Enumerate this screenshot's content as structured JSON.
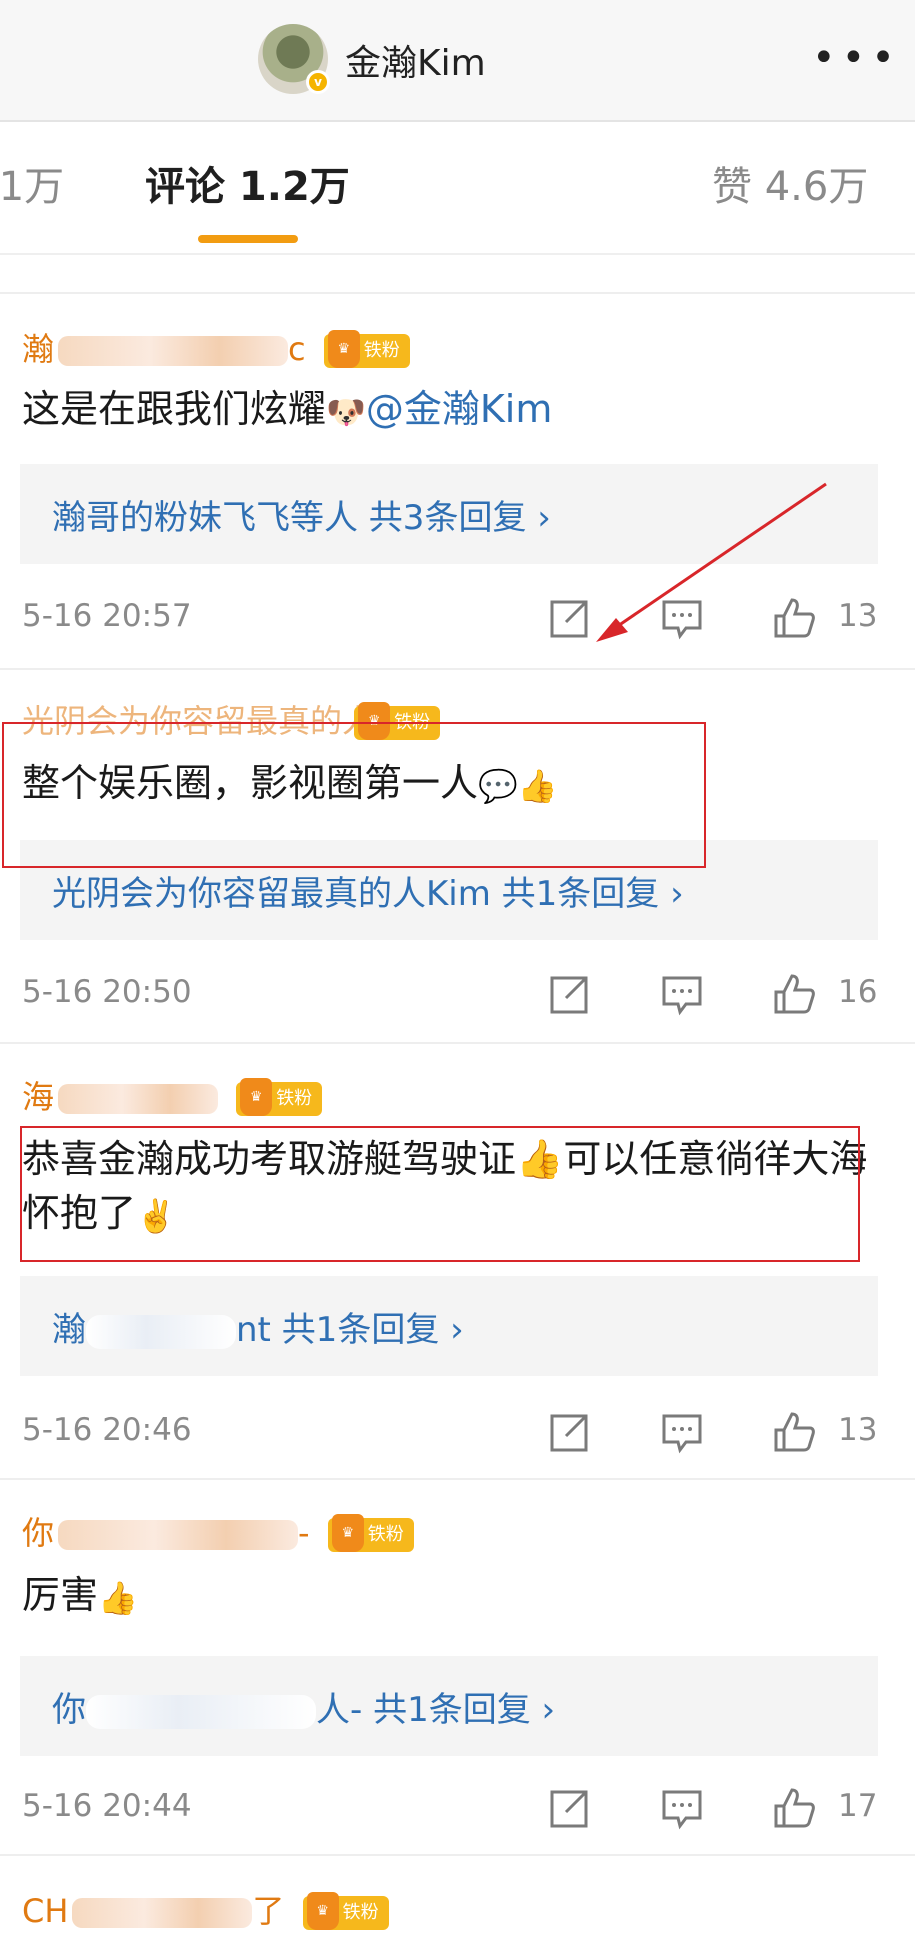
{
  "header": {
    "title": "金瀚Kim",
    "verified_mark": "v",
    "more_label": "•••"
  },
  "tabs": {
    "cut_label": ".1万",
    "active_label": "评论 1.2万",
    "likes_label": "赞 4.6万"
  },
  "badge_label": "铁粉",
  "comments": [
    {
      "name_visible": "瀚",
      "name_tail": "c",
      "text": "这是在跟我们炫耀",
      "emoji": "🐶",
      "mention": "@金瀚Kim",
      "reply_prefix": "",
      "reply_text": "瀚哥的粉妹飞飞等人 共3条回复 ›",
      "time": "5-16 20:57",
      "likes": "13"
    },
    {
      "name_visible": "光阴会为你容留最真的人",
      "text": "整个娱乐圈，影视圈第一人",
      "emoji": "💬👍",
      "reply_text": "光阴会为你容留最真的人Kim 共1条回复 ›",
      "time": "5-16 20:50",
      "likes": "16"
    },
    {
      "name_visible": "海",
      "text": "恭喜金瀚成功考取游艇驾驶证👍可以任意徜徉大海怀抱了",
      "emoji": "✌️",
      "reply_prefix": "瀚",
      "reply_text": "nt 共1条回复 ›",
      "time": "5-16 20:46",
      "likes": "13"
    },
    {
      "name_visible": "你",
      "name_tail": "-",
      "text": "厉害",
      "emoji": "👍",
      "reply_prefix": "你",
      "reply_text": "人- 共1条回复 ›",
      "time": "5-16 20:44",
      "likes": "17"
    },
    {
      "name_visible": "CH",
      "name_tail": "了"
    }
  ],
  "icons": {
    "share": "share-icon",
    "comment": "comment-icon",
    "like": "thumbs-up-icon"
  },
  "colors": {
    "accent": "#f29c11",
    "link": "#2f6fb3",
    "username": "#e07a12",
    "annotation": "#d8262a"
  }
}
